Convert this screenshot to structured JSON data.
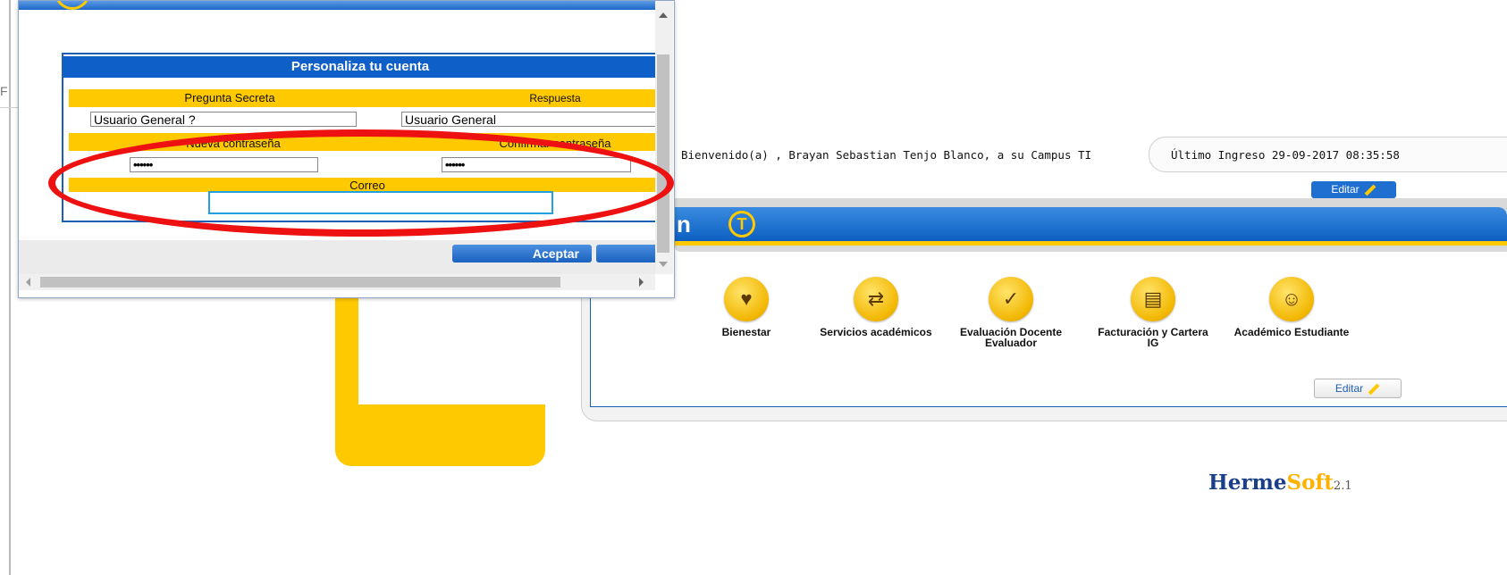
{
  "background_page": {
    "left_letter": "F",
    "welcome_text": "Bienvenido(a) , Brayan Sebastian Tenjo Blanco, a su Campus TI",
    "last_login": "Último Ingreso 29-09-2017 08:35:58",
    "edit_label": "Editar",
    "banner_text": "n",
    "apps": [
      {
        "icon": "bienestar-icon",
        "glyph": "♥",
        "label": "Bienestar"
      },
      {
        "icon": "servicios-icon",
        "glyph": "⇄",
        "label": "Servicios académicos"
      },
      {
        "icon": "evaluacion-icon",
        "glyph": "✓",
        "label": "Evaluación Docente Evaluador"
      },
      {
        "icon": "facturacion-icon",
        "glyph": "▤",
        "label": "Facturación y Cartera IG"
      },
      {
        "icon": "academico-icon",
        "glyph": "☺",
        "label": "Académico Estudiante"
      }
    ],
    "edit_label_bottom": "Editar",
    "logo": {
      "part1": "Herme",
      "part2": "Soft",
      "version": "2.1"
    }
  },
  "modal": {
    "form_title": "Personaliza tu cuenta",
    "secret_question_label": "Pregunta Secreta",
    "answer_label": "Respuesta",
    "secret_question_value": "Usuario General ?",
    "answer_value": "Usuario General",
    "new_password_label": "Nueva contraseña",
    "confirm_password_label": "Confirmar contraseña",
    "new_password_value": "••••••",
    "confirm_password_value": "••••••",
    "email_label": "Correo",
    "email_value": "",
    "accept_button": "Aceptar"
  },
  "colors": {
    "brand_blue": "#0f5fc8",
    "brand_yellow": "#ffc900",
    "highlight_red": "#ee1111"
  }
}
